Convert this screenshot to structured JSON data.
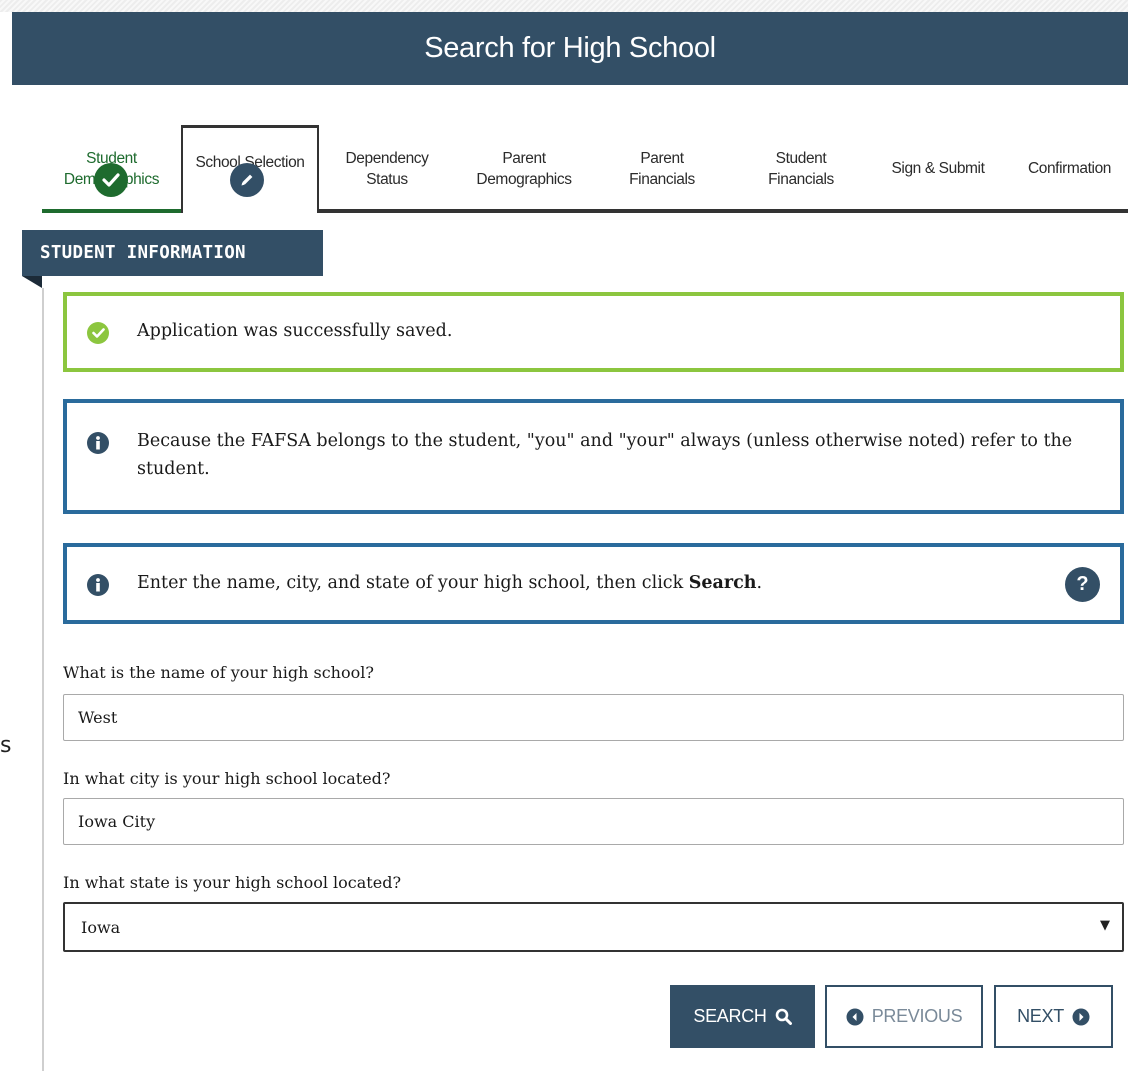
{
  "header": {
    "title": "Search for High School"
  },
  "stray_text": "s",
  "steps": [
    {
      "label": "Student\nDemographics",
      "status": "completed"
    },
    {
      "label": "School Selection",
      "status": "active"
    },
    {
      "label": "Dependency\nStatus",
      "status": "upcoming"
    },
    {
      "label": "Parent\nDemographics",
      "status": "upcoming"
    },
    {
      "label": "Parent\nFinancials",
      "status": "upcoming"
    },
    {
      "label": "Student\nFinancials",
      "status": "upcoming"
    },
    {
      "label": "Sign & Submit",
      "status": "upcoming"
    },
    {
      "label": "Confirmation",
      "status": "upcoming"
    }
  ],
  "section": {
    "title": "STUDENT INFORMATION"
  },
  "alerts": {
    "success": "Application was successfully saved.",
    "info_note": "Because the FAFSA belongs to the student, \"you\" and \"your\" always (unless otherwise noted) refer to the student.",
    "instruction_prefix": "Enter the name, city, and state of your high school, then click ",
    "instruction_bold": "Search",
    "instruction_suffix": ".",
    "help_glyph": "?"
  },
  "form": {
    "school_name": {
      "label": "What is the name of your high school?",
      "value": "West"
    },
    "city": {
      "label": "In what city is your high school located?",
      "value": "Iowa City"
    },
    "state": {
      "label": "In what state is your high school located?",
      "value": "Iowa"
    }
  },
  "buttons": {
    "search": "SEARCH",
    "previous": "PREVIOUS",
    "next": "NEXT"
  },
  "colors": {
    "header": "#334f66",
    "completed": "#1e6b2e",
    "success_border": "#8cc63f",
    "info_border": "#2a6b9c"
  }
}
